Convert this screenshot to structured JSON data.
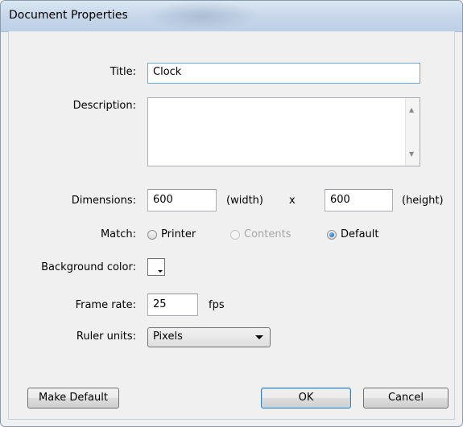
{
  "window": {
    "title": "Document Properties"
  },
  "fields": {
    "title_label": "Title:",
    "title_value": "Clock",
    "description_label": "Description:",
    "description_value": "",
    "dimensions_label": "Dimensions:",
    "width_value": "600",
    "width_unit": "(width)",
    "x_separator": "x",
    "height_value": "600",
    "height_unit": "(height)",
    "match_label": "Match:",
    "match_options": [
      {
        "label": "Printer",
        "state": "unchecked"
      },
      {
        "label": "Contents",
        "state": "disabled"
      },
      {
        "label": "Default",
        "state": "checked"
      }
    ],
    "background_label": "Background color:",
    "background_color": "#ffffff",
    "frame_rate_label": "Frame rate:",
    "frame_rate_value": "25",
    "frame_rate_unit": "fps",
    "ruler_label": "Ruler units:",
    "ruler_value": "Pixels"
  },
  "buttons": {
    "make_default": "Make Default",
    "ok": "OK",
    "cancel": "Cancel"
  }
}
